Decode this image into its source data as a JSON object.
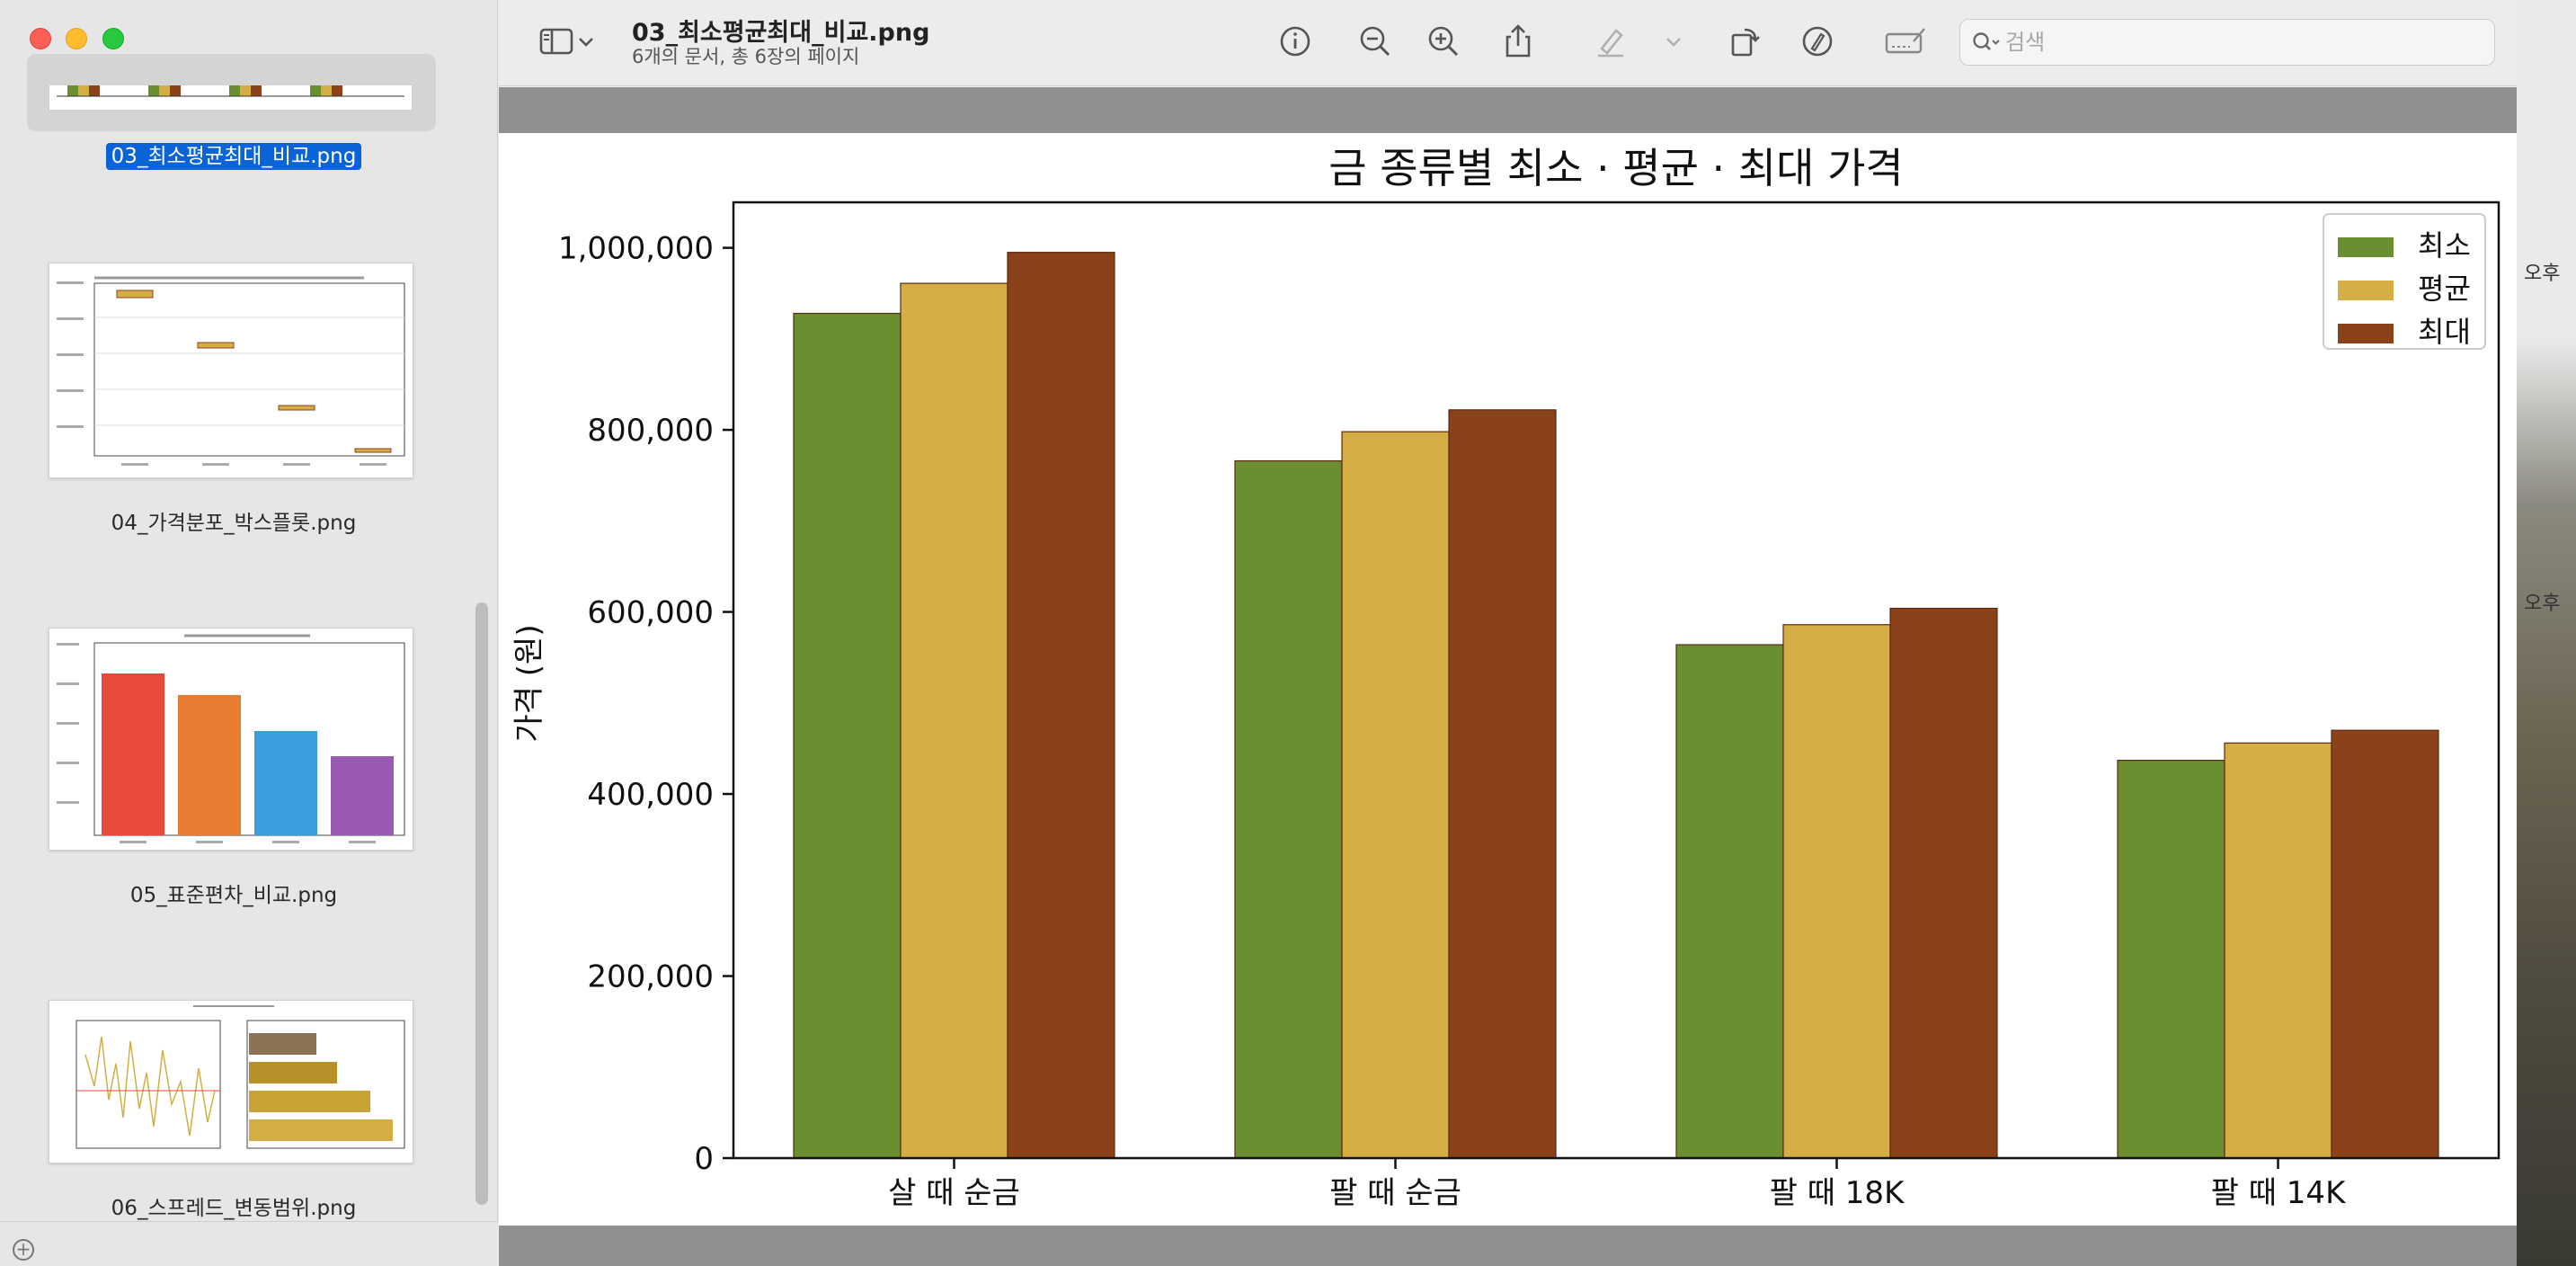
{
  "window": {
    "doc_title": "03_최소평균최대_비교.png",
    "doc_subtitle": "6개의 문서, 총 6장의 페이지"
  },
  "toolbar": {
    "search_placeholder": "검색",
    "icons": [
      "sidebar-toggle-icon",
      "chevron-down-icon",
      "info-icon",
      "zoom-out-icon",
      "zoom-in-icon",
      "share-icon",
      "highlight-icon",
      "chevron-down-icon",
      "rotate-icon",
      "markup-icon",
      "signature-icon",
      "search-icon"
    ]
  },
  "sidebar": {
    "items": [
      {
        "label": "03_최소평균최대_비교.png",
        "selected": true
      },
      {
        "label": "04_가격분포_박스플롯.png",
        "selected": false
      },
      {
        "label": "05_표준편차_비교.png",
        "selected": false
      },
      {
        "label": "06_스프레드_변동범위.png",
        "selected": false
      }
    ]
  },
  "desktop": {
    "labels": [
      "오후",
      "오후"
    ]
  },
  "chart_data": {
    "type": "bar",
    "title": "금 종류별 최소 · 평균 · 최대 가격",
    "xlabel": "",
    "ylabel": "가격 (원)",
    "categories": [
      "살 때 순금",
      "팔 때 순금",
      "팔 때 18K",
      "팔 때 14K"
    ],
    "series": [
      {
        "name": "최소",
        "color": "#6b8e31",
        "values": [
          928000,
          766000,
          564000,
          437000
        ]
      },
      {
        "name": "평균",
        "color": "#d4ae45",
        "values": [
          961000,
          798000,
          586000,
          456000
        ]
      },
      {
        "name": "최대",
        "color": "#8b421b",
        "values": [
          995000,
          822000,
          604000,
          470000
        ]
      }
    ],
    "ylim": [
      0,
      1050000
    ],
    "yticks": [
      0,
      200000,
      400000,
      600000,
      800000,
      1000000
    ],
    "ytick_labels": [
      "0",
      "200,000",
      "400,000",
      "600,000",
      "800,000",
      "1,000,000"
    ],
    "legend_position": "top-right",
    "grid": false
  }
}
